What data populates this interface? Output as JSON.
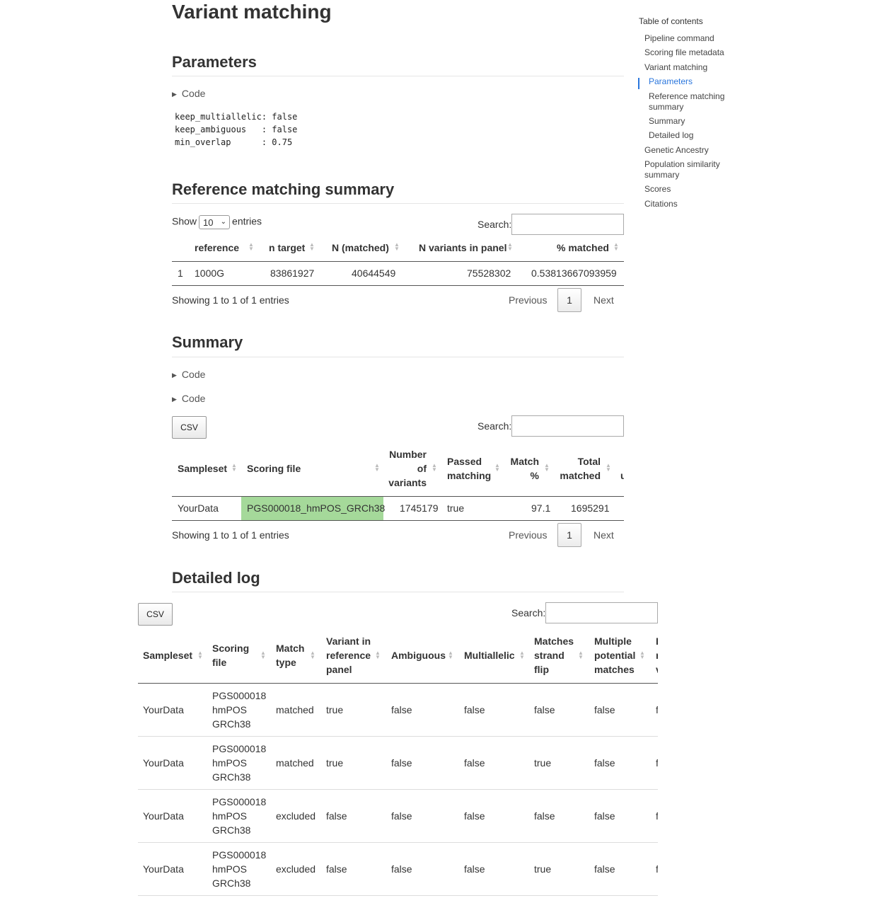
{
  "page": {
    "title": "Variant matching"
  },
  "parameters": {
    "heading": "Parameters",
    "code_label": "Code",
    "lines": [
      "keep_multiallelic: false",
      "keep_ambiguous   : false",
      "min_overlap      : 0.75"
    ]
  },
  "ref_summary": {
    "heading": "Reference matching summary",
    "show_label": "Show",
    "show_value": "10",
    "entries_label": "entries",
    "search_label": "Search:",
    "columns": [
      "reference",
      "n target",
      "N (matched)",
      "N variants in panel",
      "% matched"
    ],
    "row": {
      "index": "1",
      "reference": "1000G",
      "n_target": "83861927",
      "n_matched": "40644549",
      "n_variants_panel": "75528302",
      "pct_matched": "0.53813667093959"
    },
    "info": "Showing 1 to 1 of 1 entries",
    "previous": "Previous",
    "page": "1",
    "next": "Next"
  },
  "summary": {
    "heading": "Summary",
    "code_label_1": "Code",
    "code_label_2": "Code",
    "csv_label": "CSV",
    "search_label": "Search:",
    "columns": {
      "sampleset": "Sampleset",
      "scoring_file": "Scoring file",
      "n_var_1": "Number",
      "n_var_2": "of",
      "n_var_3": "variants",
      "passed_1": "Passed",
      "passed_2": "matching",
      "match_1": "Match",
      "match_2": "%",
      "total_1": "Total",
      "total_2": "matched",
      "cut": "u"
    },
    "row": {
      "sampleset": "YourData",
      "scoring_file": "PGS000018_hmPOS_GRCh38",
      "n_variants": "1745179",
      "passed": "true",
      "match_pct": "97.1",
      "total_matched": "1695291"
    },
    "info": "Showing 1 to 1 of 1 entries",
    "previous": "Previous",
    "page": "1",
    "next": "Next",
    "highlight_color": "#a5d99a"
  },
  "detailed_log": {
    "heading": "Detailed log",
    "csv_label": "CSV",
    "search_label": "Search:",
    "columns": {
      "sampleset": "Sampleset",
      "scoring_1": "Scoring",
      "scoring_2": "file",
      "match_1": "Match",
      "match_2": "type",
      "variant_1": "Variant in",
      "variant_2": "reference",
      "variant_3": "panel",
      "ambiguous": "Ambiguous",
      "multiallelic": "Multiallelic",
      "strand_1": "Matches",
      "strand_2": "strand",
      "strand_3": "flip",
      "multi_1": "Multiple",
      "multi_2": "potential",
      "multi_3": "matches",
      "cut_1": "I",
      "cut_2": "r",
      "cut_3": "v"
    },
    "rows": [
      {
        "sampleset": "YourData",
        "sf1": "PGS000018",
        "sf2": "hmPOS",
        "sf3": "GRCh38",
        "match_type": "matched",
        "variant_in_ref": "true",
        "ambiguous": "false",
        "multiallelic": "false",
        "strand_flip": "false",
        "multiple": "false",
        "cut": "f"
      },
      {
        "sampleset": "YourData",
        "sf1": "PGS000018",
        "sf2": "hmPOS",
        "sf3": "GRCh38",
        "match_type": "matched",
        "variant_in_ref": "true",
        "ambiguous": "false",
        "multiallelic": "false",
        "strand_flip": "true",
        "multiple": "false",
        "cut": "f"
      },
      {
        "sampleset": "YourData",
        "sf1": "PGS000018",
        "sf2": "hmPOS",
        "sf3": "GRCh38",
        "match_type": "excluded",
        "variant_in_ref": "false",
        "ambiguous": "false",
        "multiallelic": "false",
        "strand_flip": "false",
        "multiple": "false",
        "cut": "f"
      },
      {
        "sampleset": "YourData",
        "sf1": "PGS000018",
        "sf2": "hmPOS",
        "sf3": "GRCh38",
        "match_type": "excluded",
        "variant_in_ref": "false",
        "ambiguous": "false",
        "multiallelic": "false",
        "strand_flip": "true",
        "multiple": "false",
        "cut": "f"
      }
    ]
  },
  "toc": {
    "title": "Table of contents",
    "items": [
      "Pipeline command",
      "Scoring file metadata",
      "Variant matching",
      "Parameters",
      "Reference matching",
      "summary",
      "Summary",
      "Detailed log",
      "Genetic Ancestry",
      "Population similarity",
      "summary",
      "Scores",
      "Citations"
    ],
    "active_color": "#2a76dd"
  }
}
